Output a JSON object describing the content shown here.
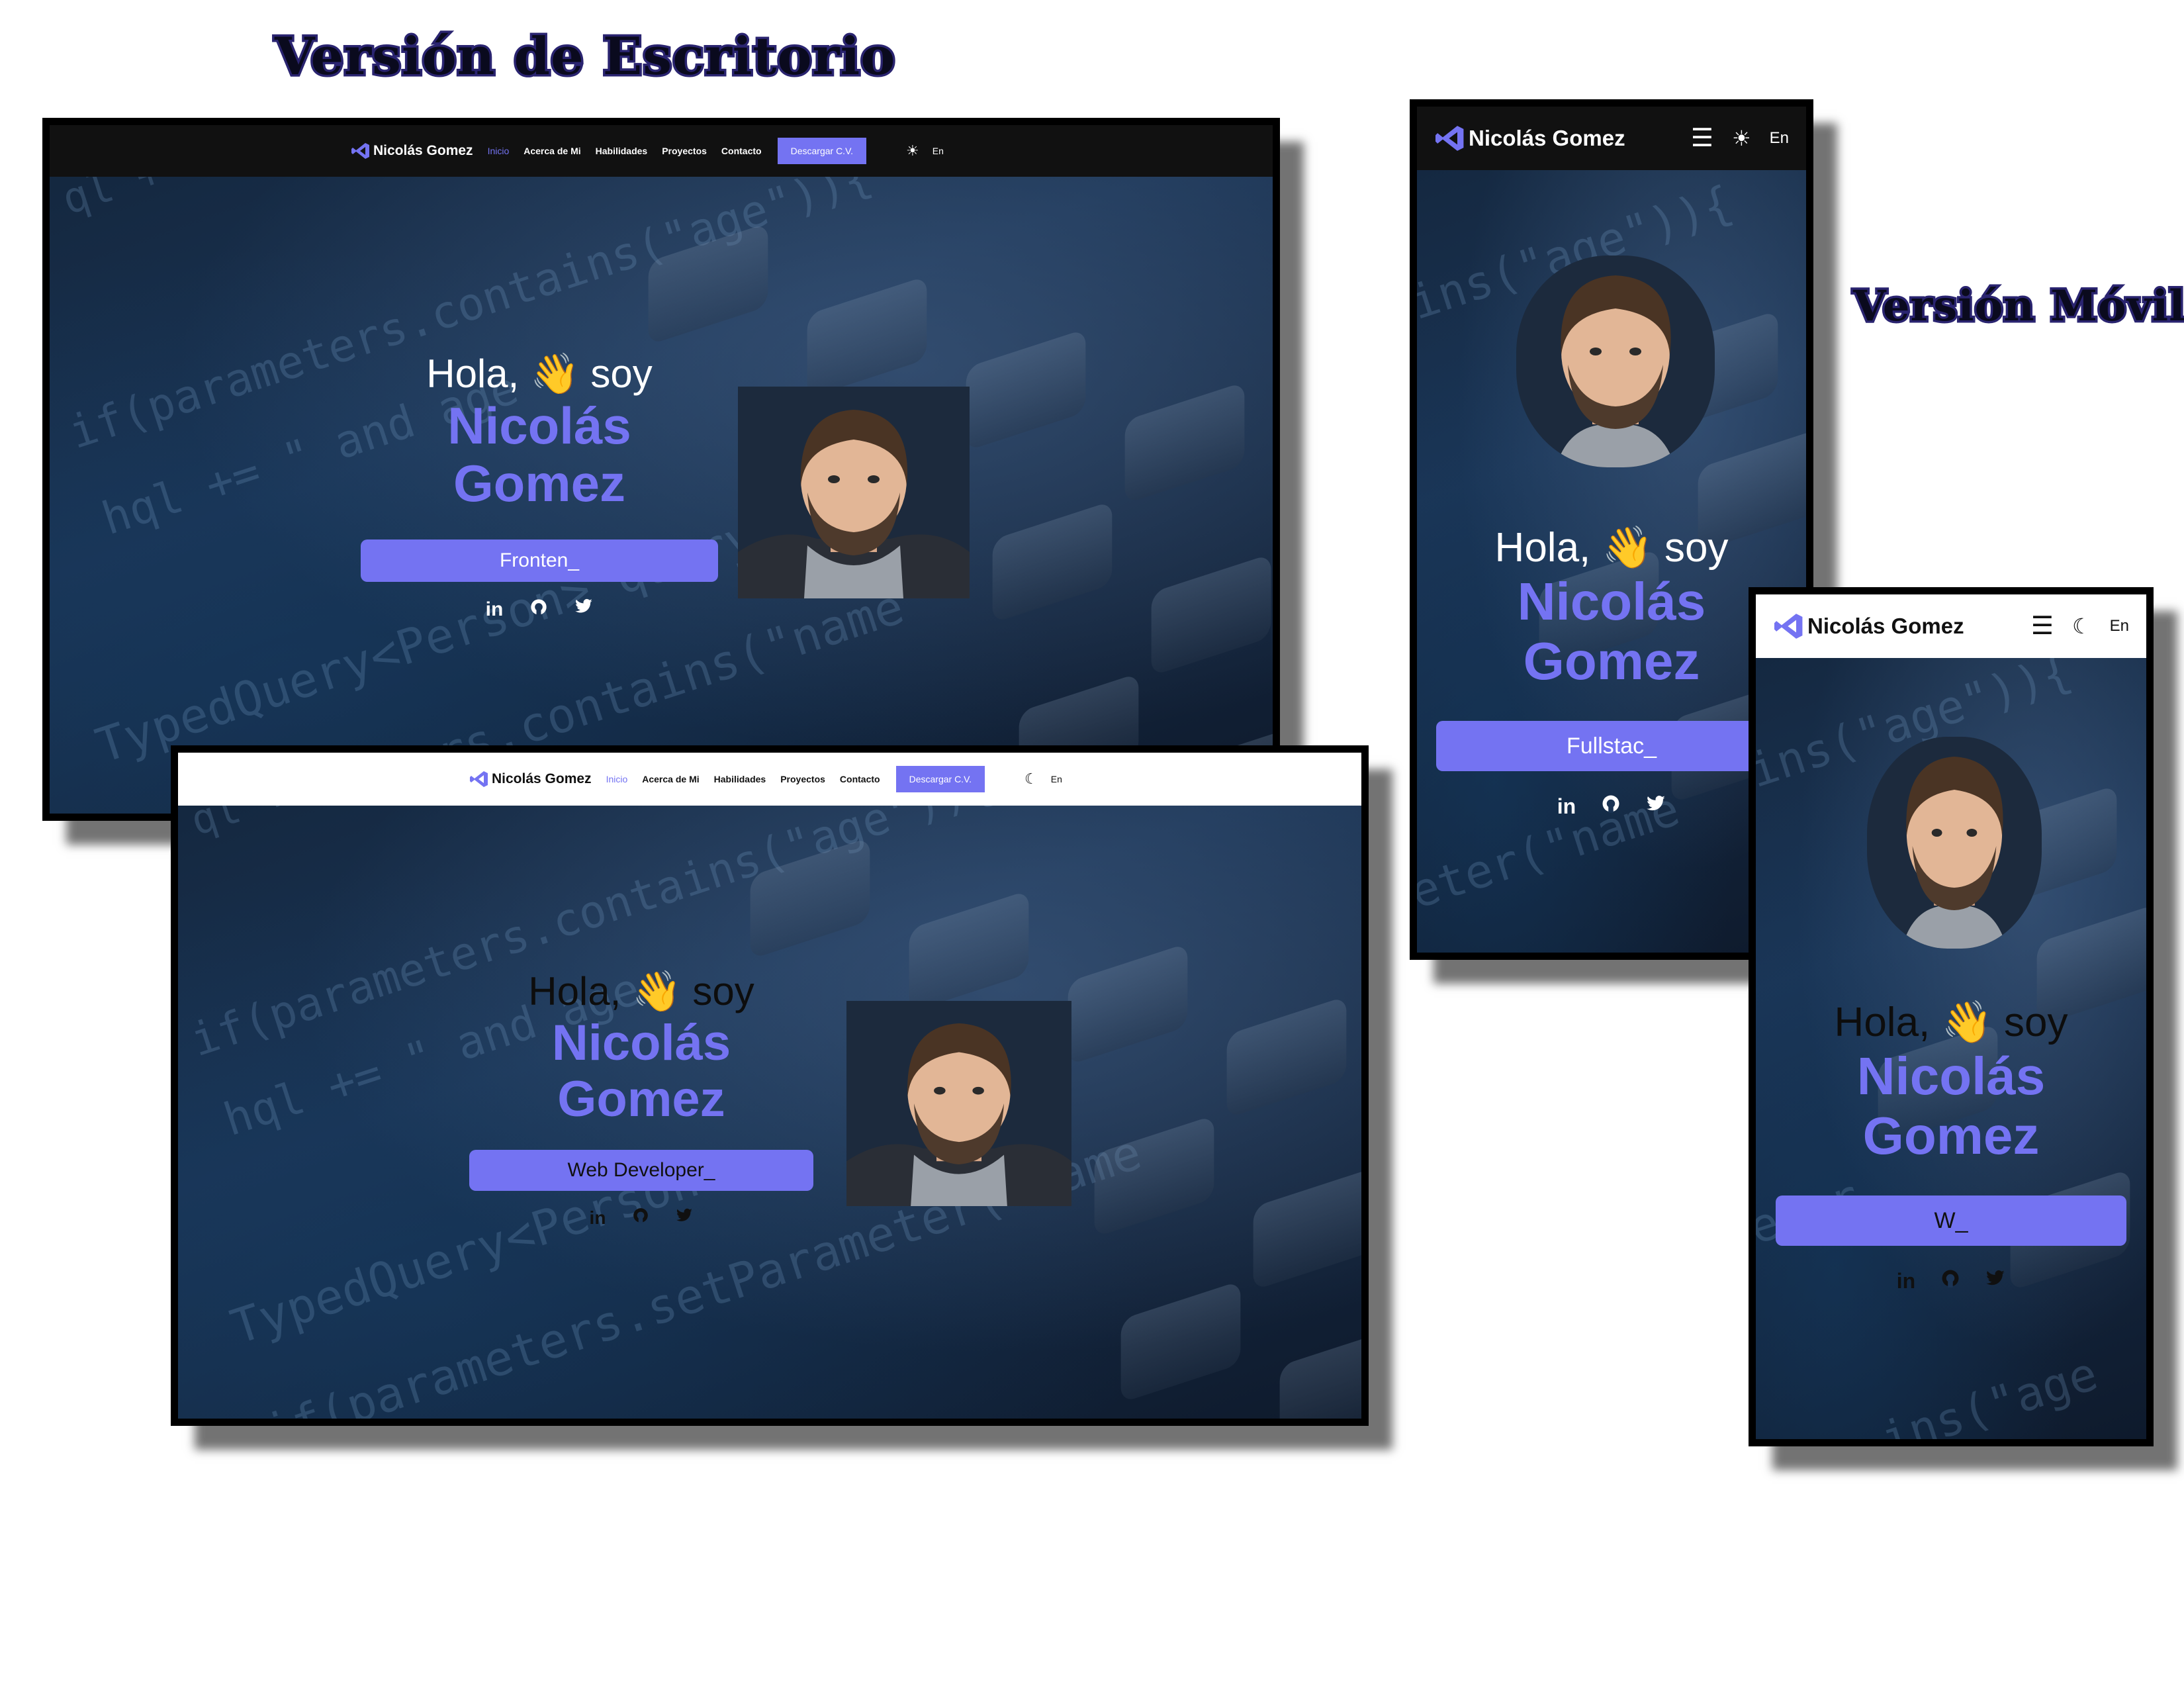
{
  "headings": {
    "desktop": "Versión de Escritorio",
    "mobile": "Versión Móvil"
  },
  "brand": {
    "name": "Nicolás Gomez",
    "accent": "#7473f2"
  },
  "nav": {
    "items": [
      "Inicio",
      "Acerca de Mi",
      "Habilidades",
      "Proyectos",
      "Contacto"
    ],
    "cv_button": "Descargar C.V.",
    "lang": "En",
    "icons": {
      "menu": "hamburger-icon",
      "sun": "sun-icon",
      "moon": "moon-icon"
    }
  },
  "hero": {
    "greeting_prefix": "Hola,",
    "wave_emoji": "👋",
    "greeting_suffix": "soy",
    "first_name": "Nicolás",
    "last_name": "Gomez"
  },
  "screens": {
    "desktop_dark": {
      "theme": "dark",
      "typed": "Fronten_"
    },
    "desktop_light": {
      "theme": "light",
      "typed": "Web Developer_"
    },
    "mobile_dark": {
      "theme": "dark",
      "typed": "Fullstac_"
    },
    "mobile_light": {
      "theme": "light",
      "typed": "W_"
    }
  },
  "socials": [
    "in",
    "github-icon",
    "twitter-icon"
  ]
}
